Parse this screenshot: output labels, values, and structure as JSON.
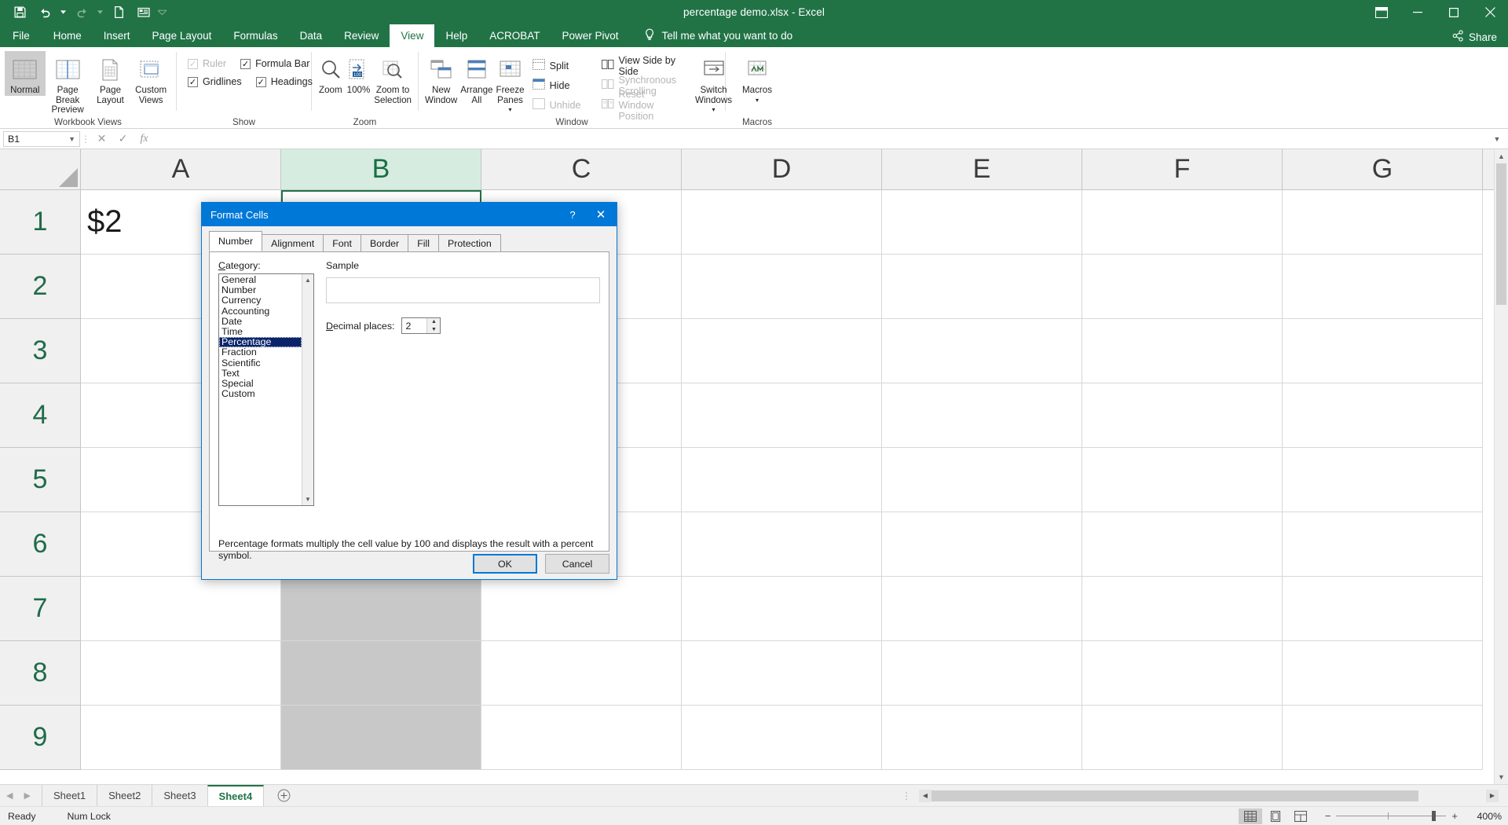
{
  "titlebar": {
    "document_title": "percentage demo.xlsx  -  Excel",
    "qat": [
      {
        "name": "save-icon",
        "label": "Save"
      },
      {
        "name": "undo-icon",
        "label": "Undo"
      },
      {
        "name": "redo-icon",
        "label": "Redo"
      },
      {
        "name": "new-icon",
        "label": "New"
      },
      {
        "name": "touch-mode-icon",
        "label": "Touch/Mouse Mode"
      },
      {
        "name": "customize-qat-icon",
        "label": "Customize Quick Access Toolbar"
      }
    ]
  },
  "ribbon_tabs": [
    {
      "label": "File",
      "active": false
    },
    {
      "label": "Home",
      "active": false
    },
    {
      "label": "Insert",
      "active": false
    },
    {
      "label": "Page Layout",
      "active": false
    },
    {
      "label": "Formulas",
      "active": false
    },
    {
      "label": "Data",
      "active": false
    },
    {
      "label": "Review",
      "active": false
    },
    {
      "label": "View",
      "active": true
    },
    {
      "label": "Help",
      "active": false
    },
    {
      "label": "ACROBAT",
      "active": false
    },
    {
      "label": "Power Pivot",
      "active": false
    }
  ],
  "tellme": {
    "label": "Tell me what you want to do"
  },
  "share": {
    "label": "Share"
  },
  "ribbon": {
    "groups": [
      {
        "name": "workbook-views",
        "label": "Workbook Views",
        "buttons": [
          {
            "label": "Normal",
            "selected": true
          },
          {
            "label": "Page Break Preview",
            "selected": false
          },
          {
            "label": "Page Layout",
            "selected": false
          },
          {
            "label": "Custom Views",
            "selected": false
          }
        ]
      },
      {
        "name": "show",
        "label": "Show",
        "checkboxes": [
          {
            "label": "Ruler",
            "checked": true,
            "disabled": true
          },
          {
            "label": "Formula Bar",
            "checked": true,
            "disabled": false
          },
          {
            "label": "Gridlines",
            "checked": true,
            "disabled": false
          },
          {
            "label": "Headings",
            "checked": true,
            "disabled": false
          }
        ]
      },
      {
        "name": "zoom",
        "label": "Zoom",
        "buttons": [
          {
            "label": "Zoom",
            "selected": false
          },
          {
            "label": "100%",
            "selected": false
          },
          {
            "label": "Zoom to Selection",
            "selected": false
          }
        ]
      },
      {
        "name": "window",
        "label": "Window",
        "buttons": [
          {
            "label": "New Window",
            "selected": false
          },
          {
            "label": "Arrange All",
            "selected": false
          },
          {
            "label": "Freeze Panes",
            "selected": false
          }
        ],
        "small_buttons": [
          {
            "label": "Split",
            "disabled": false
          },
          {
            "label": "Hide",
            "disabled": false
          },
          {
            "label": "Unhide",
            "disabled": true
          },
          {
            "label": "View Side by Side",
            "disabled": false
          },
          {
            "label": "Synchronous Scrolling",
            "disabled": true
          },
          {
            "label": "Reset Window Position",
            "disabled": true
          }
        ]
      },
      {
        "name": "macros",
        "label": "Macros",
        "buttons": [
          {
            "label": "Macros",
            "selected": false
          }
        ]
      }
    ]
  },
  "formula_bar": {
    "name_box_value": "B1",
    "formula_value": "",
    "cancel_icon": "cancel-icon",
    "enter_icon": "enter-icon",
    "function_icon": "insert-function-icon"
  },
  "grid": {
    "columns": [
      "A",
      "B",
      "C",
      "D",
      "E",
      "F",
      "G"
    ],
    "selected_column": "B",
    "rows": [
      "1",
      "2",
      "3",
      "4",
      "5",
      "6",
      "7",
      "8",
      "9"
    ],
    "cells": {
      "A1": "$2"
    }
  },
  "sheet_tabs": {
    "tabs": [
      "Sheet1",
      "Sheet2",
      "Sheet3",
      "Sheet4"
    ],
    "active": "Sheet4",
    "add_label": "+"
  },
  "status_bar": {
    "mode": "Ready",
    "num_lock": "Num Lock",
    "zoom_level": "400%",
    "view_buttons": [
      {
        "name": "normal-view-icon",
        "selected": true
      },
      {
        "name": "page-layout-view-icon",
        "selected": false
      },
      {
        "name": "page-break-preview-icon",
        "selected": false
      }
    ],
    "zoom_out_label": "−",
    "zoom_in_label": "+"
  },
  "dialog": {
    "title": "Format Cells",
    "help_label": "?",
    "close_label": "✕",
    "tabs": [
      {
        "label": "Number",
        "active": true
      },
      {
        "label": "Alignment",
        "active": false
      },
      {
        "label": "Font",
        "active": false
      },
      {
        "label": "Border",
        "active": false
      },
      {
        "label": "Fill",
        "active": false
      },
      {
        "label": "Protection",
        "active": false
      }
    ],
    "category_label": "Category:",
    "categories": [
      {
        "label": "General",
        "selected": false
      },
      {
        "label": "Number",
        "selected": false
      },
      {
        "label": "Currency",
        "selected": false
      },
      {
        "label": "Accounting",
        "selected": false
      },
      {
        "label": "Date",
        "selected": false
      },
      {
        "label": "Time",
        "selected": false
      },
      {
        "label": "Percentage",
        "selected": true
      },
      {
        "label": "Fraction",
        "selected": false
      },
      {
        "label": "Scientific",
        "selected": false
      },
      {
        "label": "Text",
        "selected": false
      },
      {
        "label": "Special",
        "selected": false
      },
      {
        "label": "Custom",
        "selected": false
      }
    ],
    "sample_label": "Sample",
    "sample_value": "",
    "decimal_label": "Decimal places:",
    "decimal_value": "2",
    "description": "Percentage formats multiply the cell value by 100 and displays the result with a percent symbol.",
    "ok_label": "OK",
    "cancel_label": "Cancel"
  },
  "colors": {
    "excel_green": "#217346",
    "dialog_blue": "#0078d7",
    "selection_blue": "#0a246a",
    "col_header_sel": "#d6ece0"
  }
}
